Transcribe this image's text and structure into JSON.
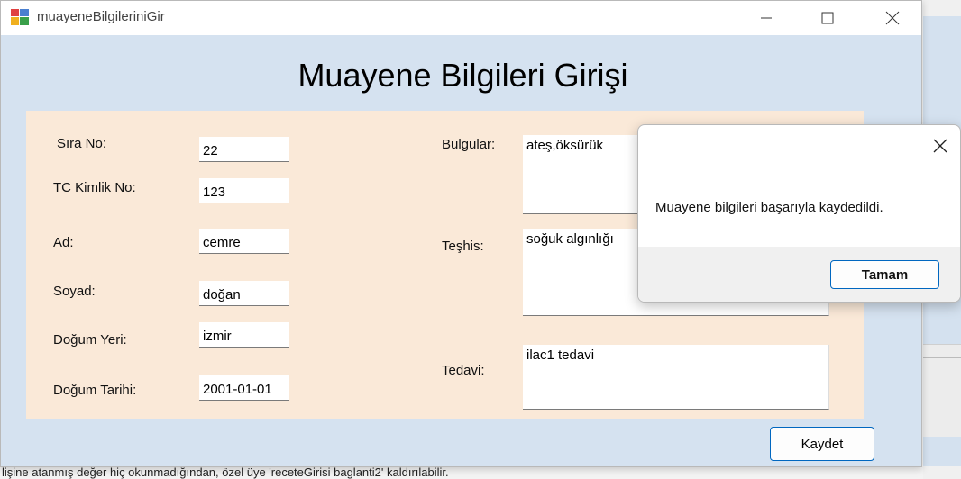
{
  "window": {
    "title": "muayeneBilgileriniGir",
    "min_glyph": "—",
    "max_glyph": "☐",
    "close_glyph": "✕"
  },
  "form": {
    "heading": "Muayene Bilgileri Girişi",
    "fields": {
      "sira_no": {
        "label": "Sıra No:",
        "value": "22"
      },
      "tc_kimlik_no": {
        "label": "TC Kimlik No:",
        "value": "123"
      },
      "ad": {
        "label": "Ad:",
        "value": "cemre"
      },
      "soyad": {
        "label": "Soyad:",
        "value": "doğan"
      },
      "dogum_yeri": {
        "label": "Doğum Yeri:",
        "value": "izmir"
      },
      "dogum_tarihi": {
        "label": "Doğum Tarihi:",
        "value": "2001-01-01"
      },
      "bulgular": {
        "label": "Bulgular:",
        "value": "ateş,öksürük"
      },
      "teshis": {
        "label": "Teşhis:",
        "value": "soğuk algınlığı"
      },
      "tedavi": {
        "label": "Tedavi:",
        "value": "ilac1 tedavi"
      }
    },
    "save_label": "Kaydet"
  },
  "message_box": {
    "text": "Muayene bilgileri başarıyla kaydedildi.",
    "ok_label": "Tamam",
    "close_glyph": "✕"
  },
  "background": {
    "bottom_text": "lişine atanmış değer hiç okunmadığından, özel üye 'receteGirisi baglanti2' kaldırılabilir."
  },
  "colors": {
    "form_bg": "#d5e2f0",
    "panel_bg": "#fae9d8",
    "accent": "#0067c0"
  }
}
